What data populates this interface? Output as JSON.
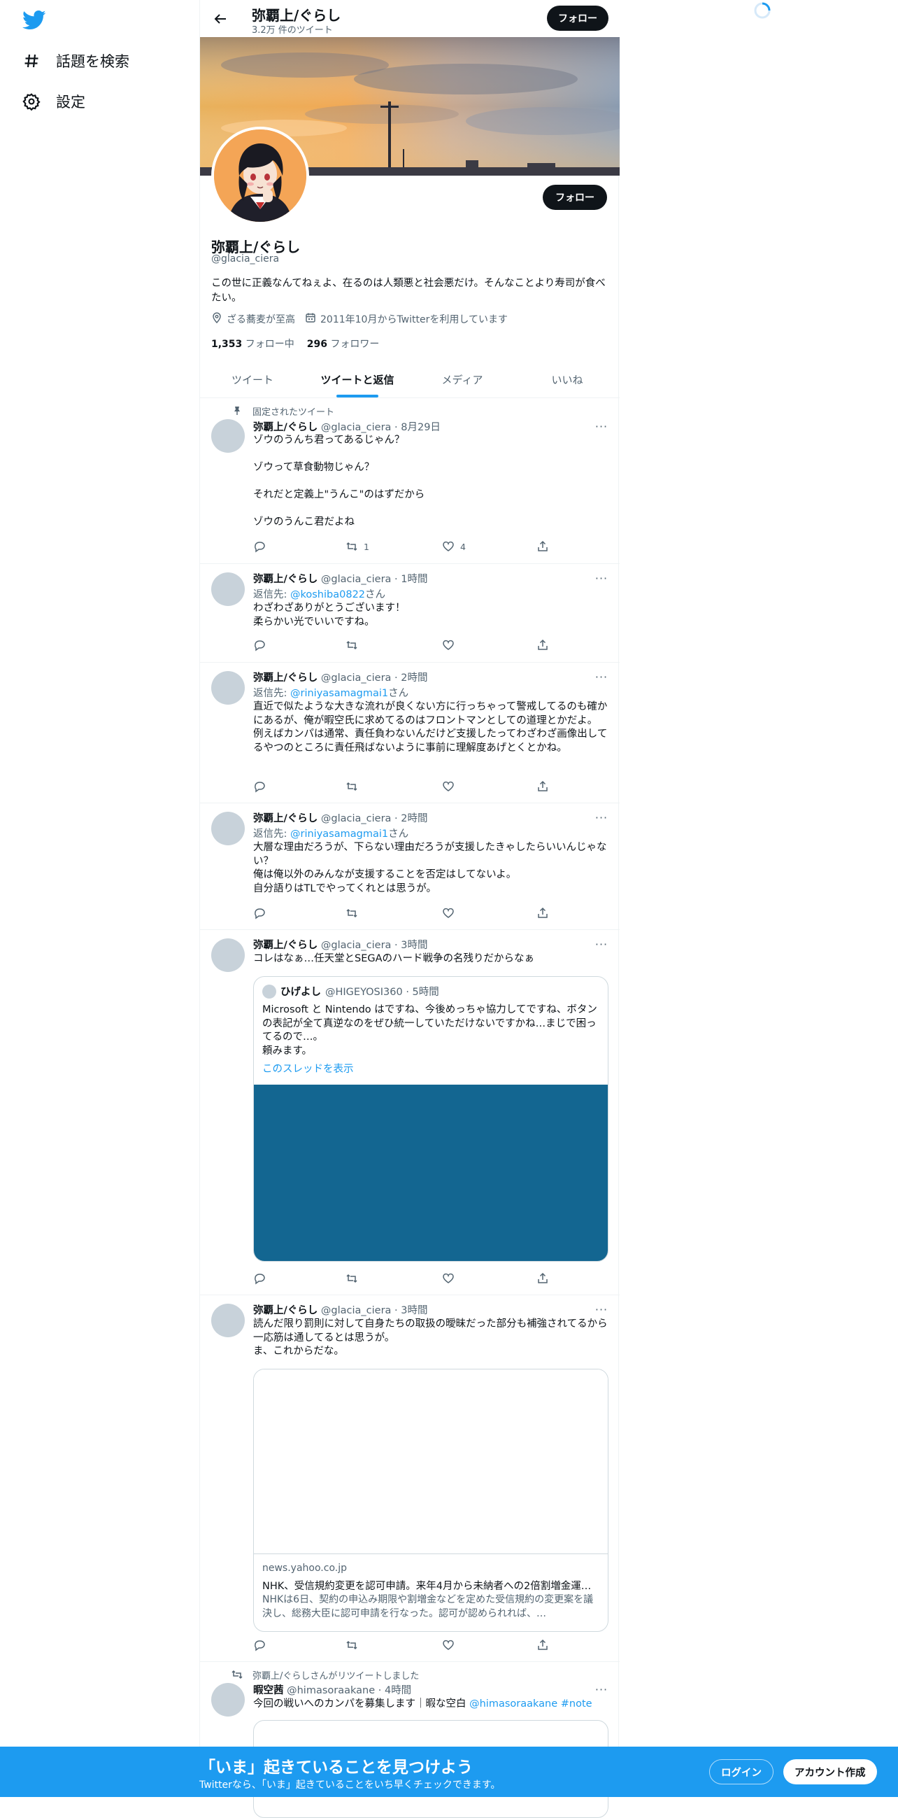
{
  "nav": {
    "explore_label": "話題を検索",
    "settings_label": "設定"
  },
  "header": {
    "title": "弥覇上/ぐらし",
    "tweet_count": "3.2万 件のツイート",
    "follow_label": "フォロー"
  },
  "profile": {
    "name": "弥覇上/ぐらし",
    "handle": "@glacia_ciera",
    "bio": "この世に正義なんてねぇよ、在るのは人類悪と社会悪だけ。そんなことより寿司が食べたい。",
    "location": "ざる蕎麦が至高",
    "joined": "2011年10月からTwitterを利用しています",
    "following_count": "1,353",
    "following_label": "フォロー中",
    "followers_count": "296",
    "followers_label": "フォロワー",
    "follow_label": "フォロー"
  },
  "tabs": [
    {
      "label": "ツイート"
    },
    {
      "label": "ツイートと返信"
    },
    {
      "label": "メディア"
    },
    {
      "label": "いいね"
    }
  ],
  "tweets": [
    {
      "context": "固定されたツイート",
      "name": "弥覇上/ぐらし",
      "meta": "@glacia_ciera · 8月29日",
      "text": "ゾウのうんち君ってあるじゃん？\n\nゾウって草食動物じゃん？\n\nそれだと定義上\"うんこ\"のはずだから\n\nゾウのうんこ君だよね",
      "retweets": "1",
      "likes": "4"
    },
    {
      "name": "弥覇上/ぐらし",
      "meta": "@glacia_ciera · 1時間",
      "reply_prefix": "返信先: ",
      "reply_to": "@koshiba0822",
      "reply_suffix": "さん",
      "text": "わざわざありがとうございます！\n柔らかい光でいいですね。"
    },
    {
      "name": "弥覇上/ぐらし",
      "meta": "@glacia_ciera · 2時間",
      "reply_prefix": "返信先: ",
      "reply_to": "@riniyasamagmai1",
      "reply_suffix": "さん",
      "text": "直近で似たような大きな流れが良くない方に行っちゃって警戒してるのも確かにあるが、俺が暇空氏に求めてるのはフロントマンとしての道理とかだよ。\n例えばカンパは通常、責任負わないんだけど支援したってわざわざ画像出してるやつのところに責任飛ばないように事前に理解度あげとくとかね。"
    },
    {
      "name": "弥覇上/ぐらし",
      "meta": "@glacia_ciera · 2時間",
      "reply_prefix": "返信先: ",
      "reply_to": "@riniyasamagmai1",
      "reply_suffix": "さん",
      "text": "大層な理由だろうが、下らない理由だろうが支援したきゃしたらいいんじゃない？\n俺は俺以外のみんなが支援することを否定はしてないよ。\n自分語りはTLでやってくれとは思うが。"
    },
    {
      "name": "弥覇上/ぐらし",
      "meta": "@glacia_ciera · 3時間",
      "text": "コレはなぁ…任天堂とSEGAのハード戦争の名残りだからなぁ",
      "quote": {
        "name": "ひげよし",
        "meta": "@HIGEYOSI360 · 5時間",
        "text": "Microsoft と Nintendo はですね、今後めっちゃ協力してですね、ボタンの表記が全て真逆なのをぜひ統一していただけないですかね…まじで困ってるので…。\n頼みます。",
        "thread_link": "このスレッドを表示"
      }
    },
    {
      "name": "弥覇上/ぐらし",
      "meta": "@glacia_ciera · 3時間",
      "text": "読んだ限り罰則に対して自身たちの取扱の曖昧だった部分も補強されてるから一応筋は通してるとは思うが。\nま、これからだな。",
      "card": {
        "domain": "news.yahoo.co.jp",
        "title": "NHK、受信規約変更を認可申請。来年4月から未納者への2倍割増金運…",
        "desc": "NHKは6日、契約の申込み期限や割増金などを定めた受信規約の変更案を議決し、総務大臣に認可申請を行なった。認可が認められれば、…"
      }
    },
    {
      "context": "弥覇上/ぐらしさんがリツイートしました",
      "name": "暇空茜",
      "meta": "@himasoraakane · 4時間",
      "text_prefix": "今回の戦いへのカンパを募集します｜暇な空白 ",
      "text_link": "@himasoraakane #note"
    }
  ],
  "bottom_bar": {
    "title": "「いま」起きていることを見つけよう",
    "subtitle": "Twitterなら、「いま」起きていることをいち早くチェックできます。",
    "login_label": "ログイン",
    "signup_label": "アカウント作成"
  },
  "colors": {
    "accent": "#1d9bf0",
    "quote_media": "#136691"
  }
}
